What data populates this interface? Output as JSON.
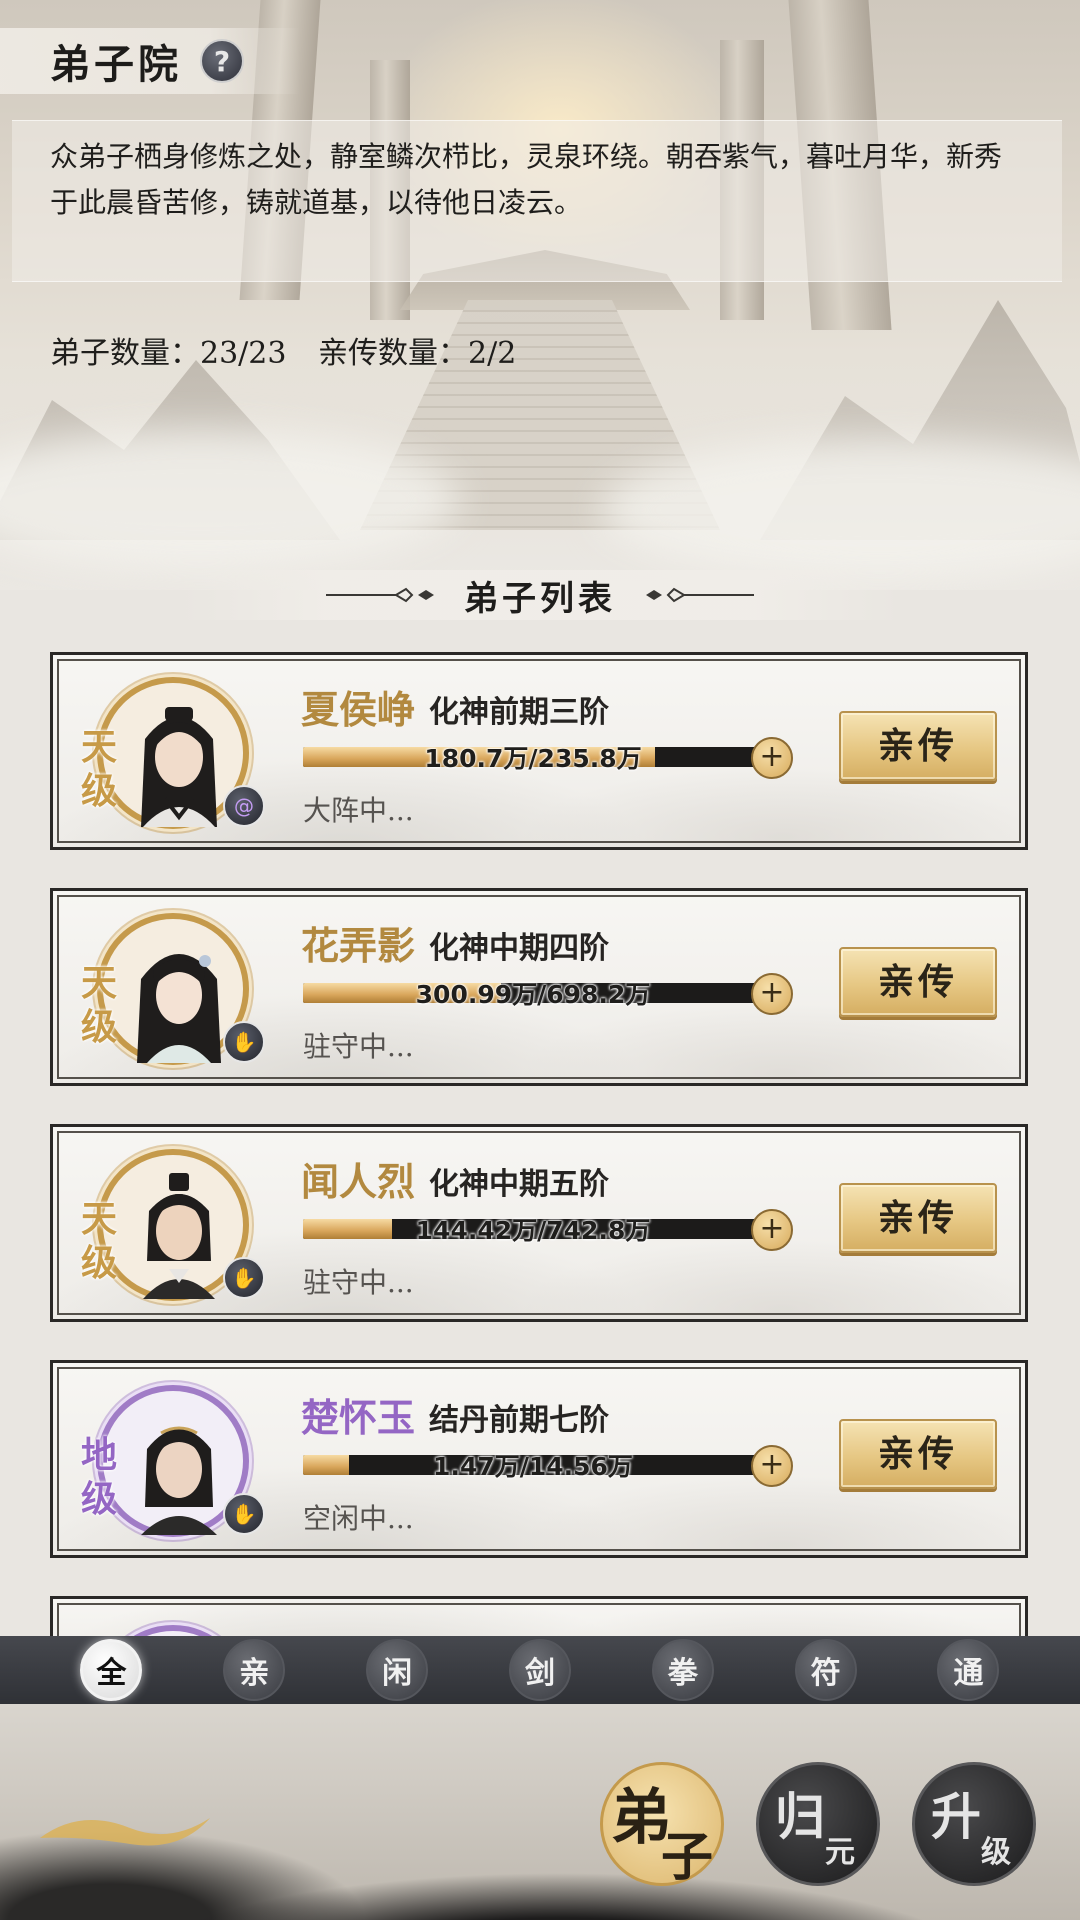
{
  "header": {
    "title": "弟子院",
    "help_icon": "?",
    "description": "众弟子栖身修炼之处，静室鳞次栉比，灵泉环绕。朝吞紫气，暮吐月华，新秀于此晨昏苦修，铸就道基，以待他日凌云。",
    "disciple_count": "弟子数量：23/23",
    "direct_count": "亲传数量：2/2"
  },
  "list": {
    "title": "弟子列表",
    "action_label": "亲传",
    "plus_label": "+",
    "items": [
      {
        "rank": "天级",
        "name": "夏侯峥",
        "realm": "化神前期三阶",
        "exp_text": "180.7万/235.8万",
        "exp_fraction": 0.766,
        "status": "大阵中...",
        "badge": "swirl-icon",
        "tier": "gold"
      },
      {
        "rank": "天级",
        "name": "花弄影",
        "realm": "化神中期四阶",
        "exp_text": "300.99万/698.2万",
        "exp_fraction": 0.431,
        "status": "驻守中...",
        "badge": "hand-icon",
        "tier": "gold"
      },
      {
        "rank": "天级",
        "name": "闻人烈",
        "realm": "化神中期五阶",
        "exp_text": "144.42万/742.8万",
        "exp_fraction": 0.194,
        "status": "驻守中...",
        "badge": "hand-icon",
        "tier": "gold"
      },
      {
        "rank": "地级",
        "name": "楚怀玉",
        "realm": "结丹前期七阶",
        "exp_text": "1.47万/14.56万",
        "exp_fraction": 0.101,
        "status": "空闲中...",
        "badge": "hand-icon",
        "tier": "purple"
      }
    ]
  },
  "filters": [
    {
      "label": "全",
      "active": true
    },
    {
      "label": "亲",
      "active": false
    },
    {
      "label": "闲",
      "active": false
    },
    {
      "label": "剑",
      "active": false
    },
    {
      "label": "拳",
      "active": false
    },
    {
      "label": "符",
      "active": false
    },
    {
      "label": "通",
      "active": false
    }
  ],
  "bottom_nav": [
    {
      "big": "弟",
      "small": "子",
      "active": true
    },
    {
      "big": "归",
      "small": "元",
      "active": false
    },
    {
      "big": "升",
      "small": "级",
      "active": false
    }
  ],
  "colors": {
    "gold": "#c79a47",
    "purple": "#9466c4",
    "button_gold": "#e6c783"
  }
}
